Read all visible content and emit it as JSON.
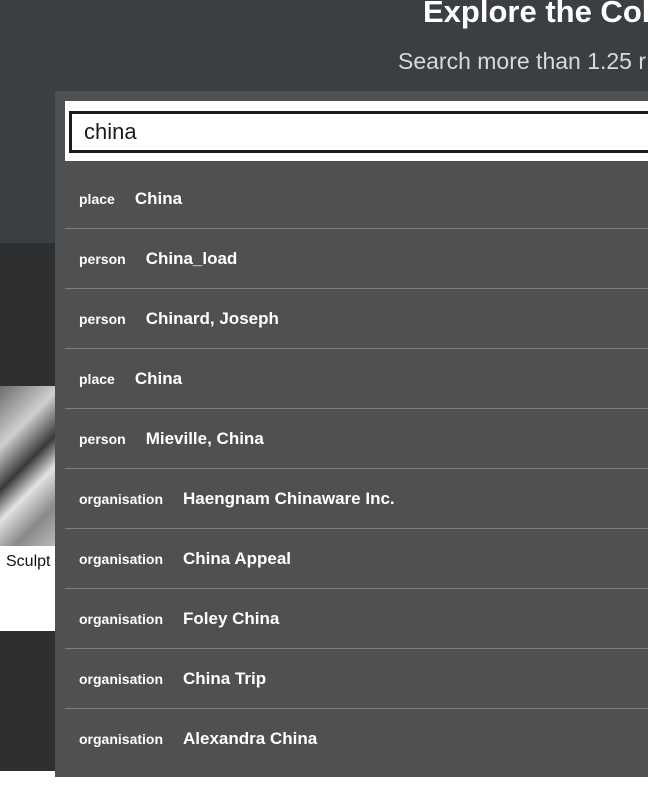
{
  "hero": {
    "title": "Explore the Col",
    "subtitle": "Search more than 1.25 r"
  },
  "card": {
    "caption": "Sculpt"
  },
  "search": {
    "value": "china"
  },
  "results": [
    {
      "type": "place",
      "label": "China"
    },
    {
      "type": "person",
      "label": "China_load"
    },
    {
      "type": "person",
      "label": "Chinard, Joseph"
    },
    {
      "type": "place",
      "label": "China"
    },
    {
      "type": "person",
      "label": "Mieville, China"
    },
    {
      "type": "organisation",
      "label": "Haengnam Chinaware Inc."
    },
    {
      "type": "organisation",
      "label": "China Appeal"
    },
    {
      "type": "organisation",
      "label": "Foley China"
    },
    {
      "type": "organisation",
      "label": "China Trip"
    },
    {
      "type": "organisation",
      "label": "Alexandra China"
    }
  ]
}
